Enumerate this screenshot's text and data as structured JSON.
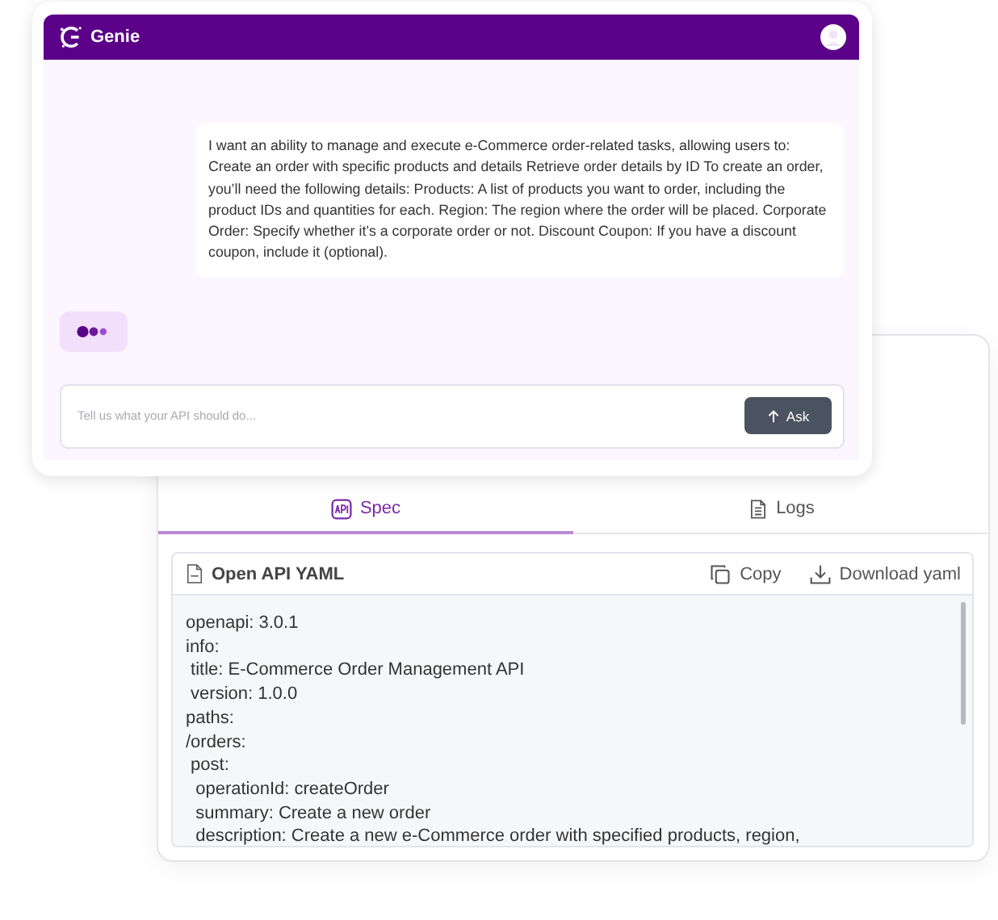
{
  "chat_window": {
    "title": "Genie",
    "message": "I want an ability to manage and execute e-Commerce order-related tasks, allowing users to: Create an order with specific products and details Retrieve order details by ID To create an order, you’ll need the following details: Products: A list of products you want to order, including the product IDs and quantities for each. Region: The region where the order will be placed. Corporate Order: Specify whether it’s a corporate order or not. Discount Coupon: If you have a discount coupon, include it (optional).",
    "input": {
      "placeholder": "Tell us what your API should do..."
    },
    "ask_button": "Ask"
  },
  "spec_window": {
    "tabs": [
      {
        "label": "Spec",
        "kind": "api",
        "selected": true
      },
      {
        "label": "Logs",
        "kind": "doc",
        "selected": false
      }
    ],
    "panel": {
      "title": "Open API YAML",
      "actions": [
        {
          "label": "Copy",
          "kind": "copy"
        },
        {
          "label": "Download yaml",
          "kind": "download"
        }
      ],
      "code_lines": [
        "openapi: 3.0.1",
        "info:",
        " title: E-Commerce Order Management API",
        " version: 1.0.0",
        "paths:",
        "/orders:",
        " post:",
        "  operationId: createOrder",
        "  summary: Create a new order",
        "  description: Create a new e-Commerce order with specified products, region,"
      ]
    }
  }
}
